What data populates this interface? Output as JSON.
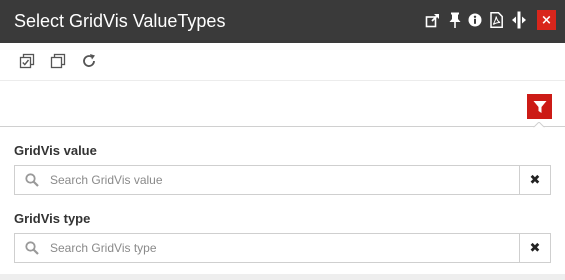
{
  "window": {
    "title": "Select GridVis ValueTypes",
    "close_glyph": "×",
    "header_icons": [
      "external-link-icon",
      "pin-icon",
      "info-icon",
      "pdf-icon",
      "resize-width-icon"
    ],
    "accent_color": "#cc1b16",
    "titlebar_color": "#3a3a3a"
  },
  "toolbar": {
    "icons": [
      "select-all-icon",
      "deselect-all-icon",
      "refresh-icon"
    ]
  },
  "filter": {
    "icon": "funnel-icon"
  },
  "fields": [
    {
      "label": "GridVis value",
      "placeholder": "Search GridVis value",
      "value": "",
      "clear_glyph": "✖"
    },
    {
      "label": "GridVis type",
      "placeholder": "Search GridVis type",
      "value": "",
      "clear_glyph": "✖"
    }
  ]
}
